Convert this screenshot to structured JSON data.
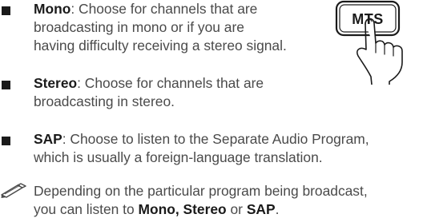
{
  "items": [
    {
      "term": "Mono",
      "lines": [
        ": Choose for channels that are",
        "broadcasting in mono or if you are",
        "having difficulty receiving a stereo signal."
      ]
    },
    {
      "term": "Stereo",
      "lines": [
        ": Choose for channels that are",
        "broadcasting in stereo."
      ]
    },
    {
      "term": "SAP",
      "lines": [
        ": Choose to listen to the Separate Audio Program,",
        "which is usually a foreign-language translation."
      ]
    }
  ],
  "note": {
    "icon": "note-pencil-icon",
    "line1": "Depending on the particular program being broadcast,",
    "line2_prefix": "you can listen to ",
    "option1": "Mono, Stereo",
    "line2_or": " or ",
    "option2": "SAP",
    "line2_suffix": "."
  },
  "illustration": {
    "icon": "mts-button-hand-icon",
    "button_label": "MTS"
  }
}
